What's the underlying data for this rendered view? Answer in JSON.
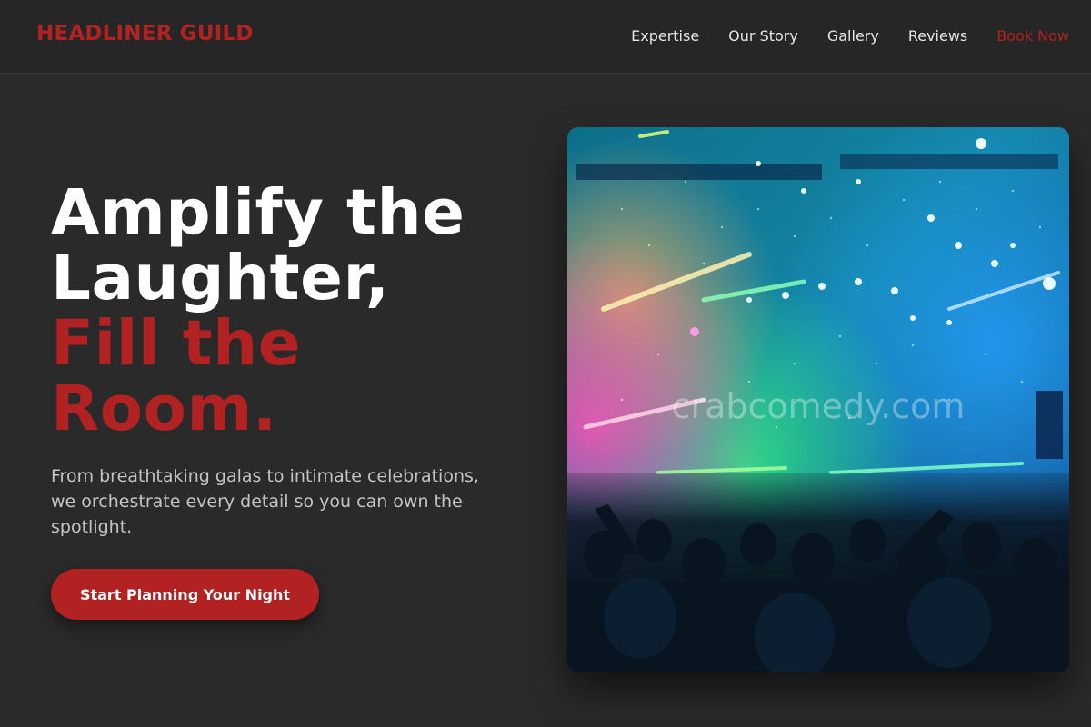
{
  "header": {
    "logo": "HEADLINER GUILD",
    "nav": [
      {
        "label": "Expertise"
      },
      {
        "label": "Our Story"
      },
      {
        "label": "Gallery"
      },
      {
        "label": "Reviews"
      },
      {
        "label": "Book Now"
      }
    ]
  },
  "hero": {
    "title_line1": "Amplify the",
    "title_line2": "Laughter,",
    "title_line3": "Fill the",
    "title_line4": "Room.",
    "subtitle": "From breathtaking galas to intimate celebrations, we orchestrate every detail so you can own the spotlight.",
    "cta_label": "Start Planning Your Night"
  },
  "image": {
    "subject": "concert-crowd-photo",
    "watermark": "crabcomedy.com"
  },
  "colors": {
    "accent": "#b22222",
    "background": "#2a2a2a",
    "header_bg": "#262626"
  }
}
